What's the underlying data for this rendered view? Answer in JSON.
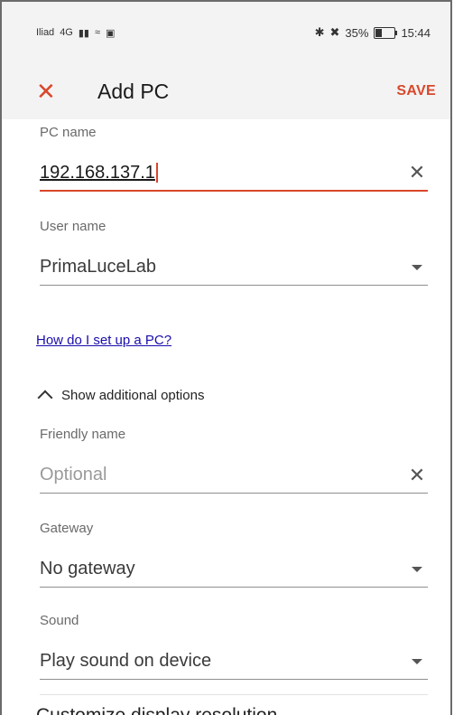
{
  "status_bar": {
    "carrier": "Iliad",
    "network": "4G",
    "battery": "35%",
    "battery_level": 0.35,
    "time": "15:44"
  },
  "app_bar": {
    "close_icon": "close-icon",
    "title": "Add PC",
    "save_label": "SAVE"
  },
  "form": {
    "pc_name": {
      "label": "PC name",
      "value": "192.168.137.1"
    },
    "user_name": {
      "label": "User name",
      "value": "PrimaLuceLab"
    },
    "help_link": "How do I set up a PC?",
    "toggle_label": "Show additional options",
    "friendly_name": {
      "label": "Friendly name",
      "placeholder": "Optional"
    },
    "gateway": {
      "label": "Gateway",
      "value": "No gateway"
    },
    "sound": {
      "label": "Sound",
      "value": "Play sound on device"
    },
    "section_next": "Customize display resolution"
  },
  "colors": {
    "accent": "#d9472b",
    "link": "#1a0dab"
  }
}
